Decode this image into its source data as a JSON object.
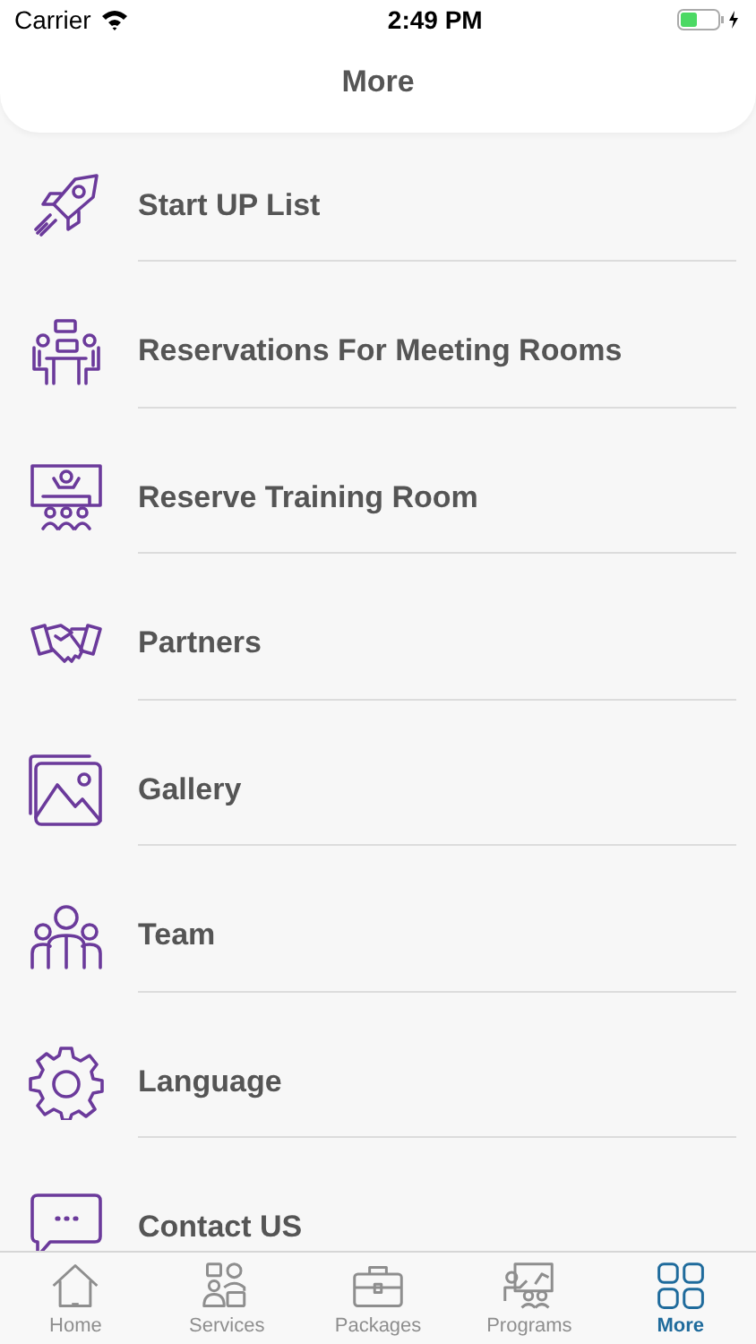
{
  "status_bar": {
    "carrier": "Carrier",
    "time": "2:49 PM",
    "battery": {
      "level": 0.45,
      "charging": true
    }
  },
  "header": {
    "title": "More"
  },
  "menu_items": [
    {
      "label": "Start UP List"
    },
    {
      "label": "Reservations For Meeting Rooms"
    },
    {
      "label": "Reserve Training Room"
    },
    {
      "label": "Partners"
    },
    {
      "label": "Gallery"
    },
    {
      "label": "Team"
    },
    {
      "label": "Language"
    },
    {
      "label": "Contact US"
    }
  ],
  "tab_bar": [
    {
      "label": "Home",
      "selected": false
    },
    {
      "label": "Services",
      "selected": false
    },
    {
      "label": "Packages",
      "selected": false
    },
    {
      "label": "Programs",
      "selected": false
    },
    {
      "label": "More",
      "selected": true
    }
  ]
}
